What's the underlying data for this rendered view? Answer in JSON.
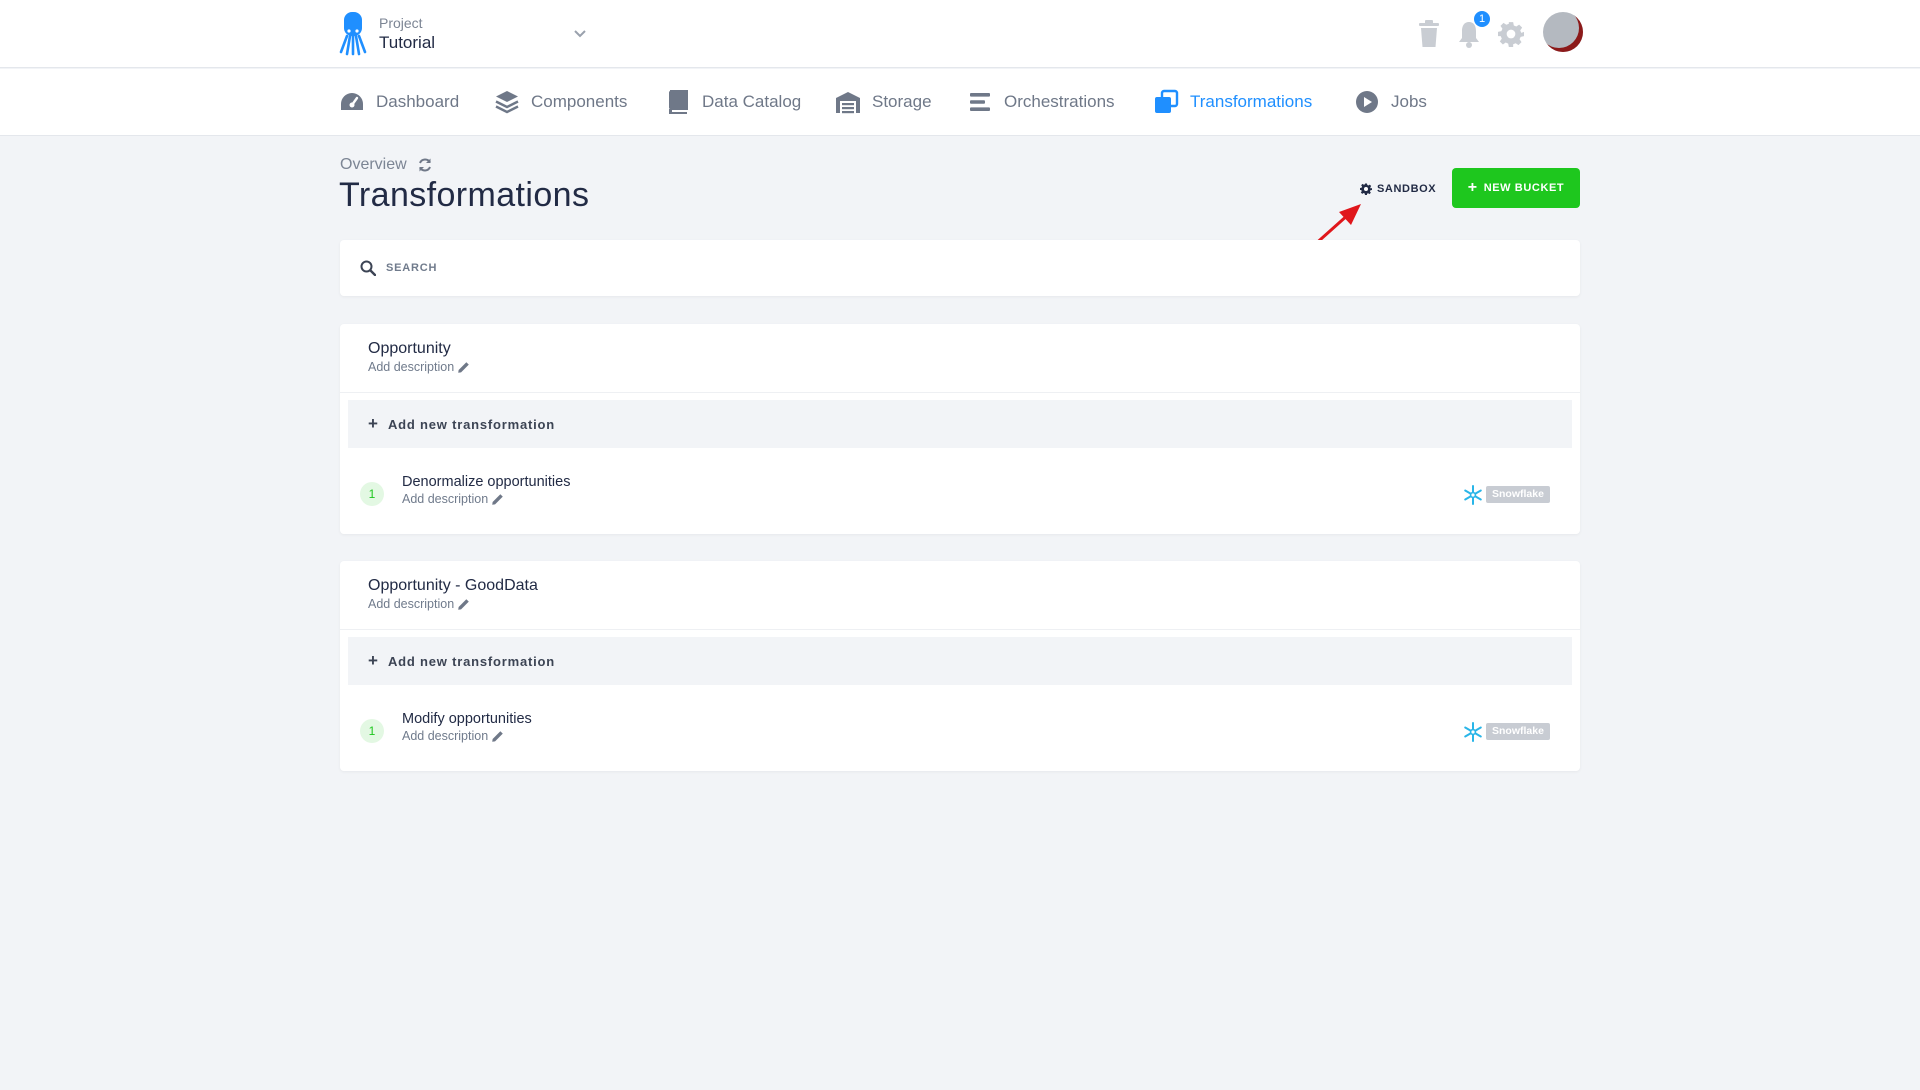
{
  "project": {
    "label": "Project",
    "name": "Tutorial"
  },
  "notifications": {
    "count": "1"
  },
  "nav": [
    {
      "label": "Dashboard",
      "icon": "dashboard-icon",
      "active": false
    },
    {
      "label": "Components",
      "icon": "layers-icon",
      "active": false
    },
    {
      "label": "Data Catalog",
      "icon": "book-icon",
      "active": false
    },
    {
      "label": "Storage",
      "icon": "warehouse-icon",
      "active": false
    },
    {
      "label": "Orchestrations",
      "icon": "bars-icon",
      "active": false
    },
    {
      "label": "Transformations",
      "icon": "transformations-icon",
      "active": true
    },
    {
      "label": "Jobs",
      "icon": "play-circle-icon",
      "active": false
    }
  ],
  "page": {
    "breadcrumb": "Overview",
    "title": "Transformations",
    "sandbox_label": "SANDBOX",
    "new_bucket_label": "NEW BUCKET"
  },
  "search": {
    "placeholder": "SEARCH"
  },
  "buckets": [
    {
      "name": "Opportunity",
      "description": "Add description",
      "add_label": "Add new transformation",
      "transformations": [
        {
          "phase": "1",
          "name": "Denormalize opportunities",
          "description": "Add description",
          "backend": "Snowflake"
        }
      ]
    },
    {
      "name": "Opportunity - GoodData",
      "description": "Add description",
      "add_label": "Add new transformation",
      "transformations": [
        {
          "phase": "1",
          "name": "Modify opportunities",
          "description": "Add description",
          "backend": "Snowflake"
        }
      ]
    }
  ],
  "colors": {
    "accent": "#1f8fff",
    "success": "#1ec71e",
    "annotation": "#e0161b"
  }
}
